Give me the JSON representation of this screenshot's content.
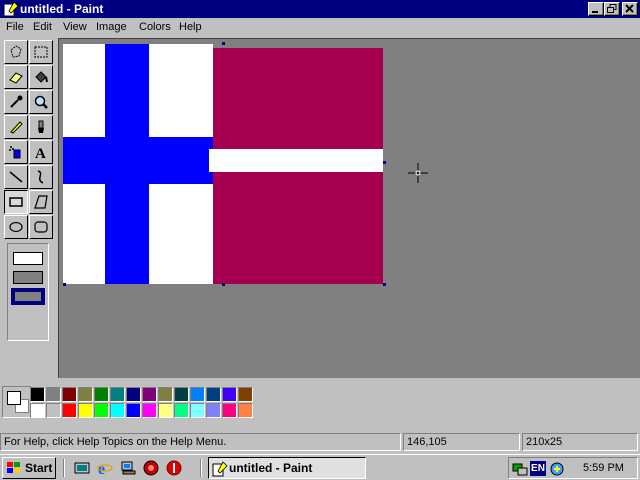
{
  "window": {
    "title": "untitled - Paint"
  },
  "menu": [
    "File",
    "Edit",
    "View",
    "Image",
    "Colors",
    "Help"
  ],
  "tools": [
    "free-form-select",
    "select",
    "eraser",
    "fill-with-color",
    "pick-color",
    "magnifier",
    "pencil",
    "brush",
    "airbrush",
    "text",
    "line",
    "curve",
    "rectangle",
    "polygon",
    "ellipse",
    "rounded-rectangle"
  ],
  "selected_tool": "rectangle",
  "tool_options": {
    "selected": 3,
    "count": 3
  },
  "canvas": {
    "finland_blue": "#0000ff",
    "denmark_red": "#a50050",
    "white": "#ffffff",
    "background": "#808080"
  },
  "colors": {
    "top": [
      "#000000",
      "#808080",
      "#800000",
      "#808040",
      "#008000",
      "#008080",
      "#000080",
      "#800080",
      "#808040",
      "#004040",
      "#0080ff",
      "#004080",
      "#4000ff",
      "#804000"
    ],
    "bottom": [
      "#ffffff",
      "#c0c0c0",
      "#ff0000",
      "#ffff00",
      "#00ff00",
      "#00ffff",
      "#0000ff",
      "#ff00ff",
      "#ffff80",
      "#00ff80",
      "#80ffff",
      "#8080ff",
      "#ff0080",
      "#ff8040"
    ]
  },
  "status": {
    "help": "For Help, click Help Topics on the Help Menu.",
    "coords": "146,105",
    "size": "210x25"
  },
  "taskbar": {
    "start": "Start",
    "task": "untitled - Paint",
    "lang": "EN",
    "clock": "5:59 PM"
  }
}
